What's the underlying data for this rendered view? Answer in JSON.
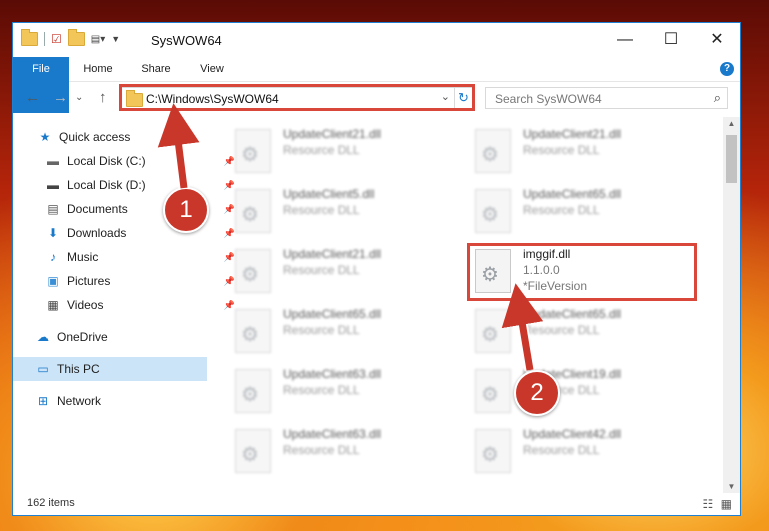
{
  "window": {
    "title": "SysWOW64",
    "controls": {
      "minimize": "—",
      "maximize": "☐",
      "close": "✕"
    }
  },
  "ribbon": {
    "tabs": [
      "File",
      "Home",
      "Share",
      "View"
    ],
    "help": "?"
  },
  "nav": {
    "address": "C:\\Windows\\SysWOW64",
    "search_placeholder": "Search SysWOW64"
  },
  "sidebar": {
    "items": [
      {
        "label": "Quick access",
        "icon": "★"
      },
      {
        "label": "Local Disk (C:)",
        "icon": "▬"
      },
      {
        "label": "Local Disk (D:)",
        "icon": "▬"
      },
      {
        "label": "Documents",
        "icon": "▤"
      },
      {
        "label": "Downloads",
        "icon": "⬇"
      },
      {
        "label": "Music",
        "icon": "♪"
      },
      {
        "label": "Pictures",
        "icon": "▣"
      },
      {
        "label": "Videos",
        "icon": "▦"
      },
      {
        "label": "OneDrive",
        "icon": "☁"
      },
      {
        "label": "This PC",
        "icon": "▭"
      },
      {
        "label": "Network",
        "icon": "⊞"
      }
    ]
  },
  "files": [
    {
      "name": "UpdateClient21.dll",
      "line1": "Resource DLL",
      "line2": ""
    },
    {
      "name": "UpdateClient21.dll",
      "line1": "Resource DLL",
      "line2": ""
    },
    {
      "name": "UpdateClient5.dll",
      "line1": "Resource DLL",
      "line2": ""
    },
    {
      "name": "UpdateClient65.dll",
      "line1": "Resource DLL",
      "line2": ""
    },
    {
      "name": "UpdateClient21.dll",
      "line1": "Resource DLL",
      "line2": ""
    },
    {
      "name": "imggif.dll",
      "line1": "1.1.0.0",
      "line2": "*FileVersion"
    },
    {
      "name": "UpdateClient65.dll",
      "line1": "Resource DLL",
      "line2": ""
    },
    {
      "name": "UpdateClient65.dll",
      "line1": "Resource DLL",
      "line2": ""
    },
    {
      "name": "UpdateClient63.dll",
      "line1": "Resource DLL",
      "line2": ""
    },
    {
      "name": "UpdateClient19.dll",
      "line1": "Resource DLL",
      "line2": ""
    },
    {
      "name": "UpdateClient63.dll",
      "line1": "Resource DLL",
      "line2": ""
    },
    {
      "name": "UpdateClient42.dll",
      "line1": "Resource DLL",
      "line2": ""
    }
  ],
  "status": {
    "count": "162 items"
  },
  "callouts": [
    "1",
    "2"
  ],
  "colors": {
    "accent": "#1979ca",
    "highlight": "#d9463a",
    "callout": "#c9362a"
  }
}
